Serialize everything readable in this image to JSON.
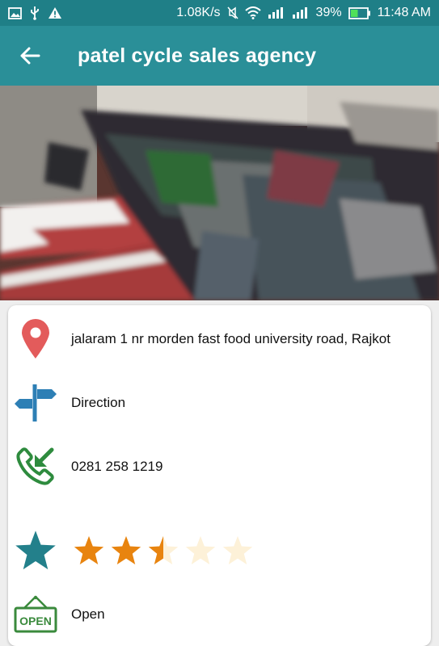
{
  "status_bar": {
    "network_speed": "1.08K/s",
    "battery": "39%",
    "time": "11:48 AM"
  },
  "app_bar": {
    "title": "patel cycle sales agency"
  },
  "details": {
    "address": "jalaram 1 nr morden fast food university road, Rajkot",
    "direction_label": "Direction",
    "phone": "0281 258 1219",
    "rating": 2.5,
    "rating_max": 5,
    "open_status": "Open",
    "open_sign_text": "OPEN"
  },
  "colors": {
    "app_bar": "#2a8f98",
    "status_bar": "#1f7f87",
    "pin": "#e35b5b",
    "direction": "#2d7fb5",
    "phone": "#2e8b3e",
    "star_filled": "#e8840f",
    "star_empty": "#fdf1d8",
    "open_sign": "#3a8a3c"
  }
}
